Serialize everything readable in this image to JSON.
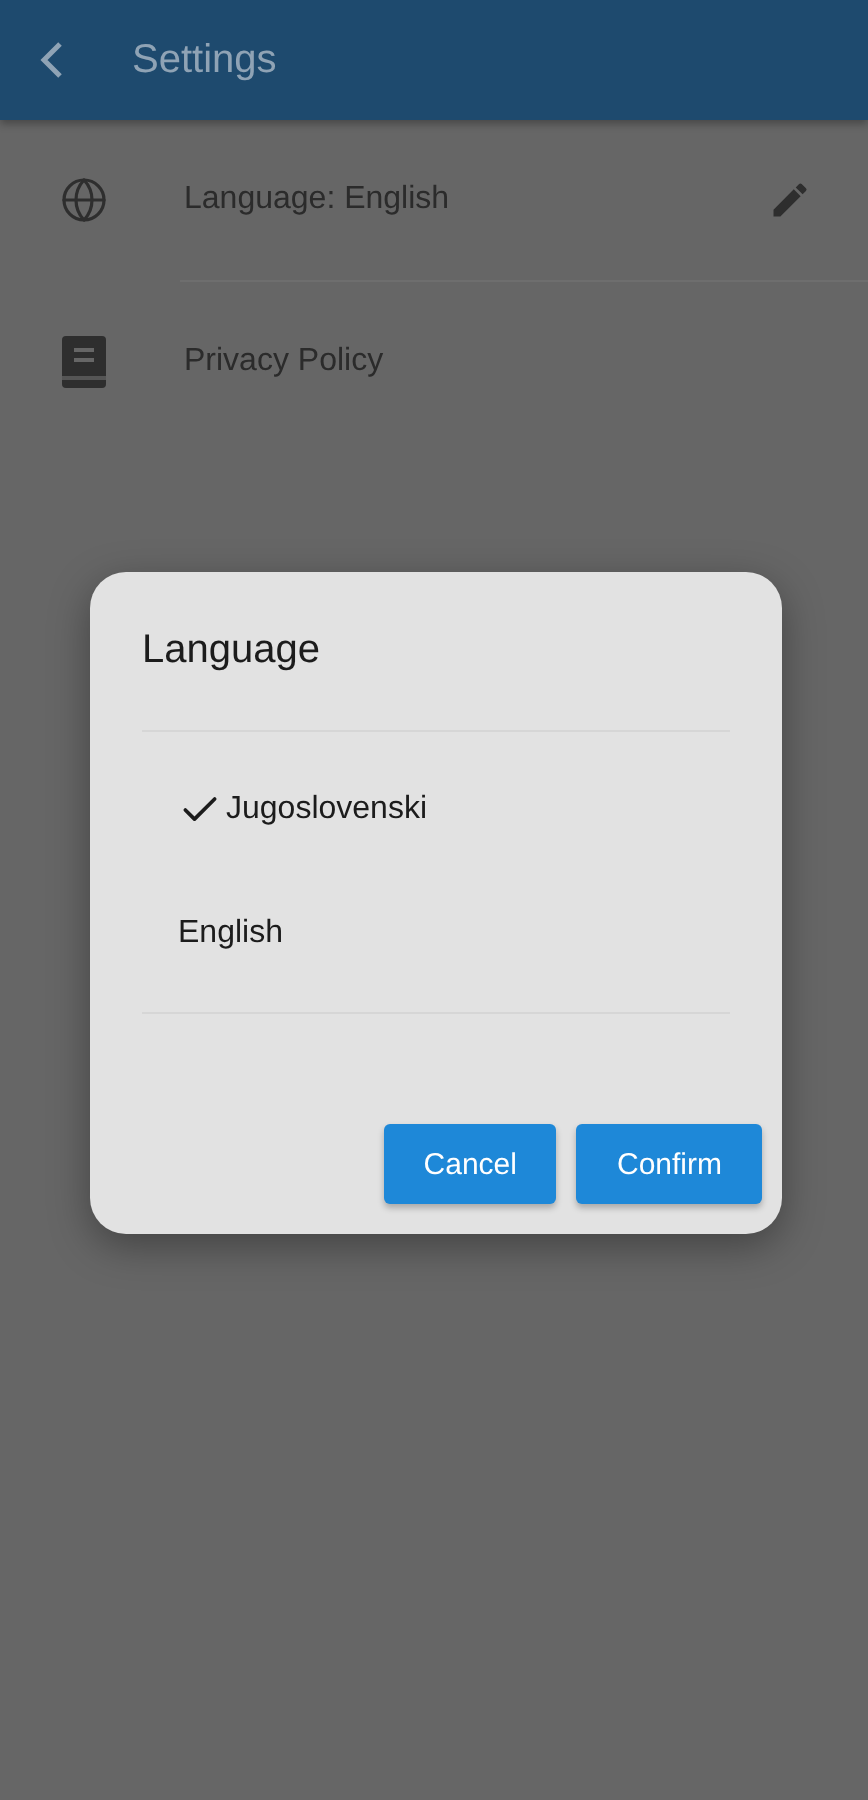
{
  "app_bar": {
    "title": "Settings"
  },
  "settings_items": [
    {
      "kind": "language",
      "label": "Language: English",
      "editable": true
    },
    {
      "kind": "privacy",
      "label": "Privacy Policy",
      "editable": false
    }
  ],
  "dialog": {
    "title": "Language",
    "options": [
      {
        "label": "Jugoslovenski",
        "selected": true
      },
      {
        "label": "English",
        "selected": false
      }
    ],
    "buttons": [
      "Cancel",
      "Confirm"
    ]
  }
}
